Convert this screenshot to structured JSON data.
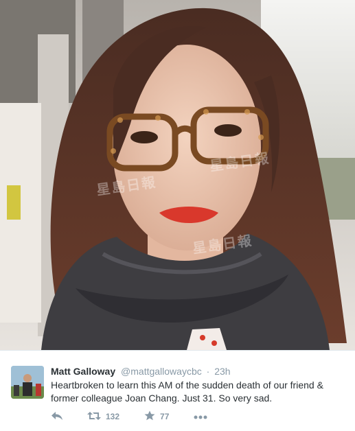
{
  "photo": {
    "watermark_text": "星島日報"
  },
  "tweet": {
    "author_name": "Matt Galloway",
    "author_handle": "@mattgallowaycbc",
    "separator": "·",
    "time": "23h",
    "text": "Heartbroken to learn this AM of the sudden death of our friend & former colleague Joan Chang. Just 31. So very sad.",
    "retweet_count": "132",
    "favorite_count": "77"
  },
  "icons": {
    "reply": "reply-icon",
    "retweet": "retweet-icon",
    "favorite": "star-icon",
    "more": "more-icon"
  },
  "colors": {
    "muted": "#8899a6",
    "text": "#292f33",
    "divider": "#e1e8ed"
  }
}
